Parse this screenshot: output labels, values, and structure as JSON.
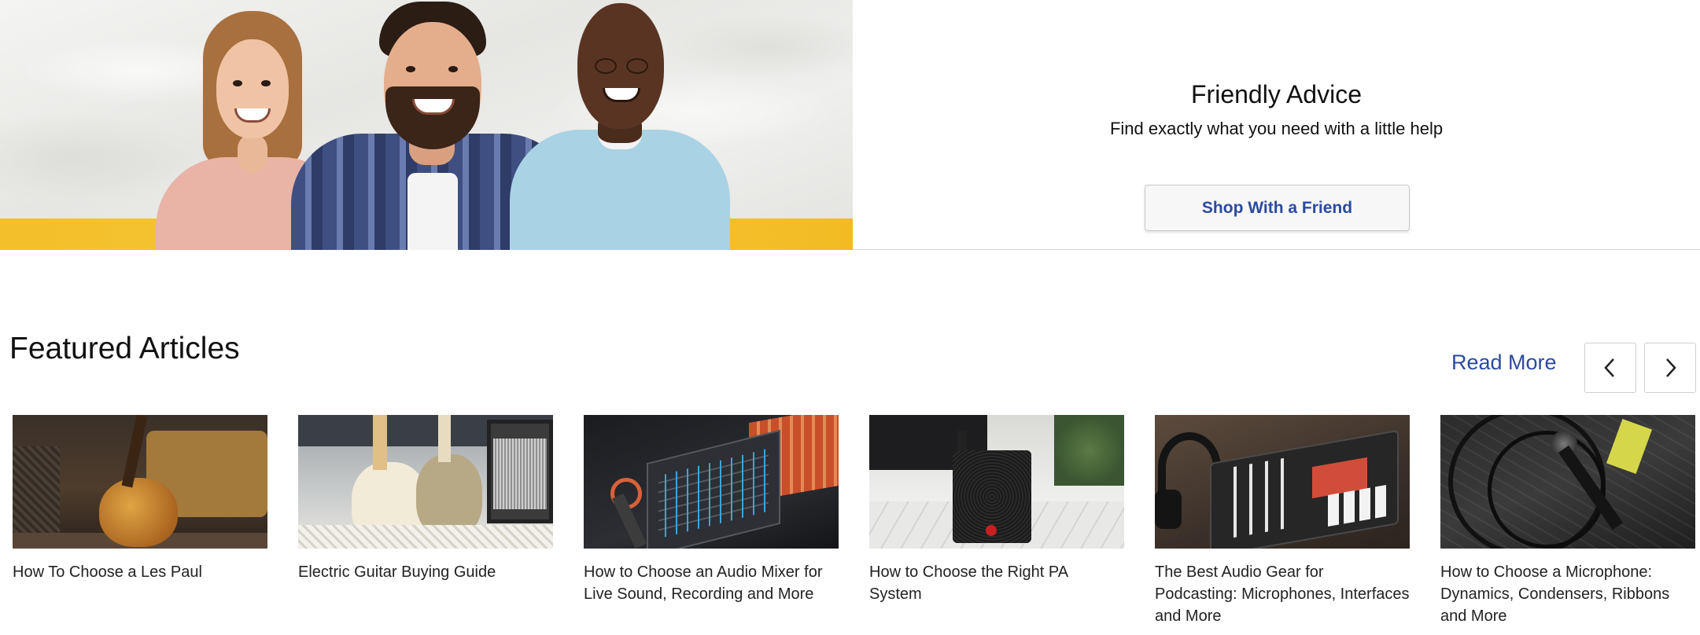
{
  "hero": {
    "title": "Friendly Advice",
    "subtitle": "Find exactly what you need with a little help",
    "button_label": "Shop With a Friend"
  },
  "featured": {
    "title": "Featured Articles",
    "read_more": "Read More",
    "prev_icon": "chevron-left-icon",
    "next_icon": "chevron-right-icon",
    "articles": [
      {
        "title": "How To Choose a Les Paul"
      },
      {
        "title": "Electric Guitar Buying Guide"
      },
      {
        "title": "How to Choose an Audio Mixer for Live Sound, Recording and More"
      },
      {
        "title": "How to Choose the Right PA System"
      },
      {
        "title": "The Best Audio Gear for Podcasting: Microphones, Interfaces and More"
      },
      {
        "title": "How to Choose a Microphone: Dynamics, Condensers, Ribbons and More"
      }
    ]
  },
  "colors": {
    "accent_blue": "#2b4aa0",
    "banner_yellow": "#f3bf2a"
  }
}
